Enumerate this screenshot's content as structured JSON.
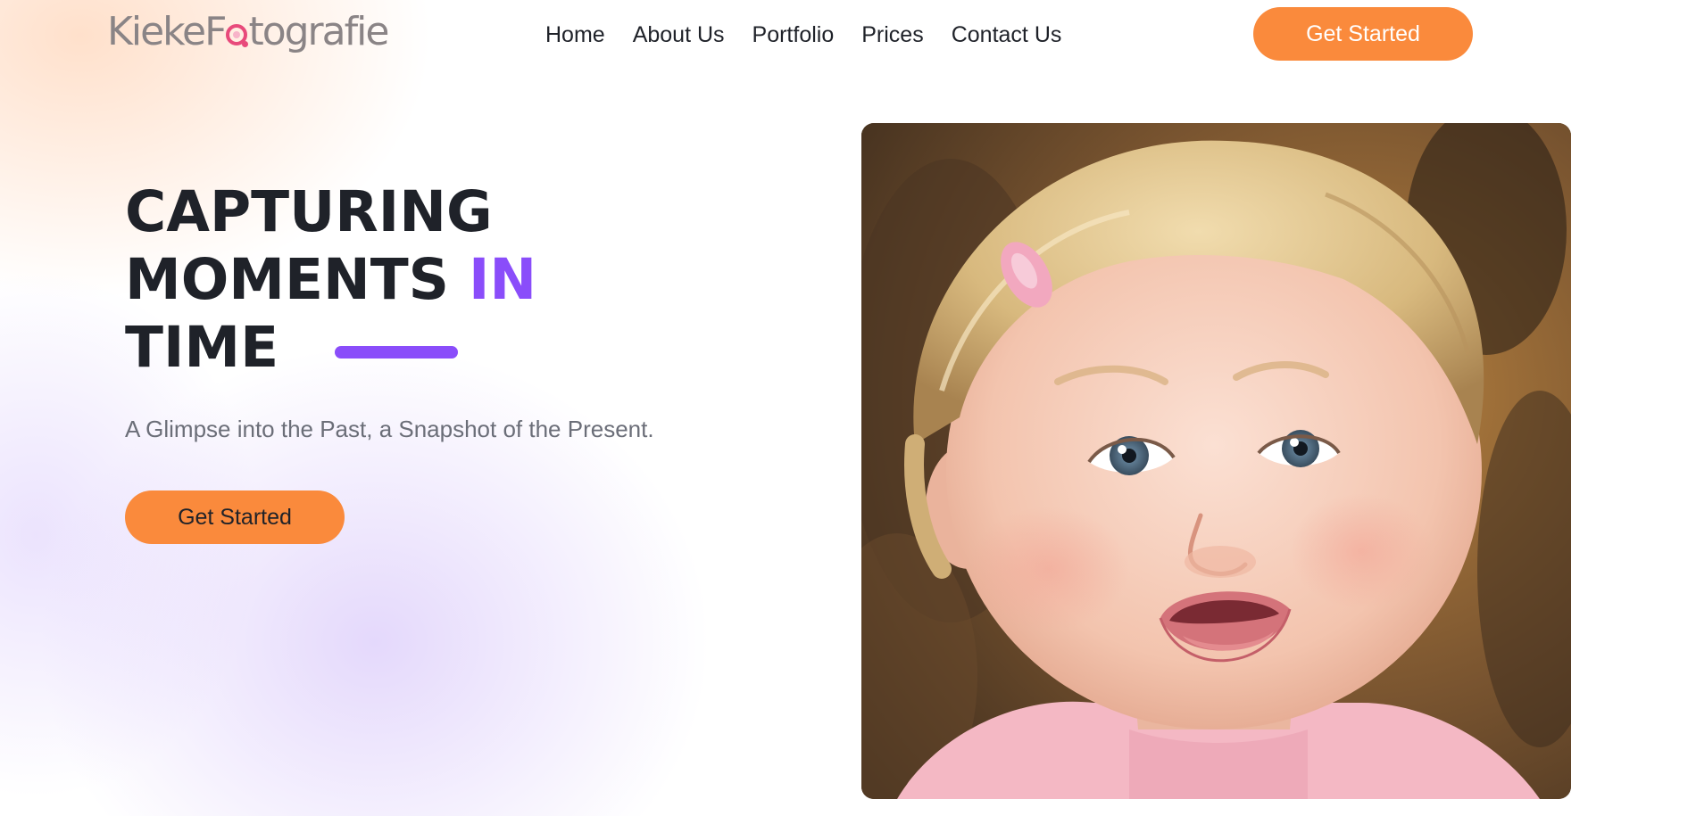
{
  "header": {
    "logo_text_left": "Kieke",
    "logo_text_f": "F",
    "logo_text_right": "tografie",
    "nav": [
      {
        "label": "Home"
      },
      {
        "label": "About Us"
      },
      {
        "label": "Portfolio"
      },
      {
        "label": "Prices"
      },
      {
        "label": "Contact Us"
      }
    ],
    "cta_label": "Get Started"
  },
  "hero": {
    "title_line1": "CAPTURING",
    "title_line2_a": "MOMENTS ",
    "title_line2_accent": "IN",
    "title_line3": "TIME",
    "subtitle": "A Glimpse into the Past, a Snapshot of the Present.",
    "cta_label": "Get Started"
  },
  "colors": {
    "accent_orange": "#fa8a3c",
    "accent_purple": "#8a4dfa",
    "text_dark": "#1f2229",
    "text_muted": "#6b6e78",
    "logo_gray": "#8a8486",
    "logo_pink": "#e84a7b"
  }
}
